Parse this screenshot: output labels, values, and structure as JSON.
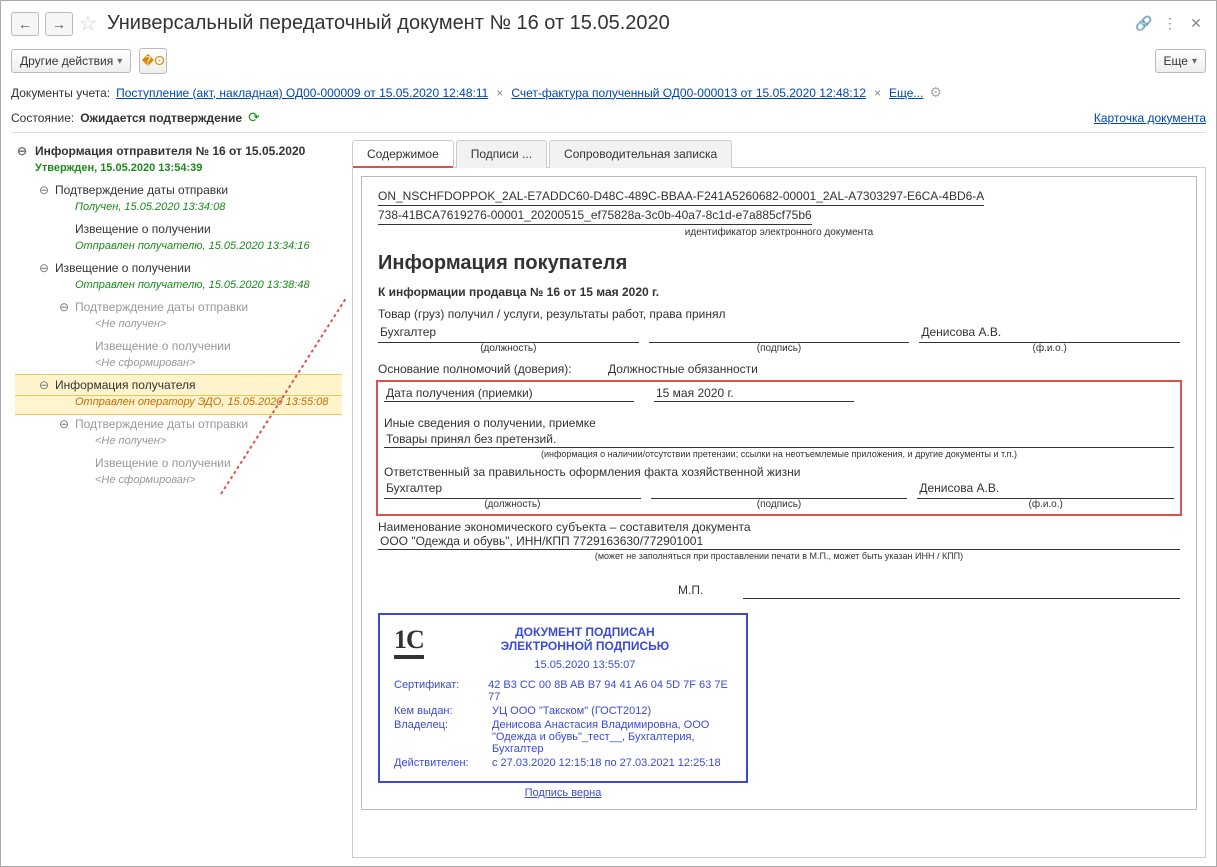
{
  "title": "Универсальный передаточный документ № 16 от 15.05.2020",
  "toolbar": {
    "other_actions": "Другие действия",
    "more": "Еще"
  },
  "docs": {
    "label": "Документы учета:",
    "link1": "Поступление (акт, накладная) ОД00-000009 от 15.05.2020 12:48:11",
    "link2": "Счет-фактура полученный ОД00-000013 от 15.05.2020 12:48:12",
    "more": "Еще..."
  },
  "state": {
    "label": "Состояние:",
    "value": "Ожидается подтверждение"
  },
  "card_link": "Карточка документа",
  "tree": {
    "root": "Информация отправителя № 16 от 15.05.2020",
    "root_status": "Утвержден, 15.05.2020 13:54:39",
    "n1": "Подтверждение даты отправки",
    "n1_status": "Получен, 15.05.2020 13:34:08",
    "n1a": "Извещение о получении",
    "n1a_status": "Отправлен получателю, 15.05.2020 13:34:16",
    "n2": "Извещение о получении",
    "n2_status": "Отправлен получателю, 15.05.2020 13:38:48",
    "n2a": "Подтверждение даты отправки",
    "n2a_status": "<Не получен>",
    "n2a1": "Извещение о получении",
    "n2a1_status": "<Не сформирован>",
    "n3": "Информация получателя",
    "n3_status": "Отправлен оператору ЭДО, 15.05.2020 13:55:08",
    "n3a": "Подтверждение даты отправки",
    "n3a_status": "<Не получен>",
    "n3a1": "Извещение о получении",
    "n3a1_status": "<Не сформирован>"
  },
  "tabs": {
    "t1": "Содержимое",
    "t2": "Подписи ...",
    "t3": "Сопроводительная записка"
  },
  "doc": {
    "file_id1": "ON_NSCHFDOPPOK_2AL-E7ADDC60-D48C-489C-BBAA-F241A5260682-00001_2AL-A7303297-E6CA-4BD6-A",
    "file_id2": "738-41BCA7619276-00001_20200515_ef75828a-3c0b-40a7-8c1d-e7a885cf75b6",
    "file_id_cap": "идентификатор электронного документа",
    "h1": "Информация покупателя",
    "sub": "К информации продавца № 16 от 15 мая 2020 г.",
    "received_label": "Товар (груз) получил / услуги, результаты работ, права принял",
    "position_cap": "(должность)",
    "signature_cap": "(подпись)",
    "fio_cap": "(ф.и.о.)",
    "position_value": "Бухгалтер",
    "fio_value": "Денисова А.В.",
    "auth_label": "Основание полномочий (доверия):",
    "auth_value": "Должностные обязанности",
    "date_label": "Дата получения (приемки)",
    "date_value": "15 мая 2020 г.",
    "other_label": "Иные сведения о получении, приемке",
    "other_value": "Товары принял без претензий.",
    "other_cap": "(информация о наличии/отсутствии претензии; ссылки на неотъемлемые приложения, и другие  документы и т.п.)",
    "resp_label": "Ответственный за правильность оформления факта хозяйственной жизни",
    "resp_position": "Бухгалтер",
    "resp_fio": "Денисова А.В.",
    "subj_label": "Наименование экономического субъекта – составителя документа",
    "subj_value": "ООО \"Одежда и обувь\", ИНН/КПП 7729163630/772901001",
    "subj_cap": "(может не заполняться при проставлении печати в М.П., может быть указан ИНН / КПП)",
    "mp": "М.П.",
    "stamp": {
      "title1": "ДОКУМЕНТ ПОДПИСАН",
      "title2": "ЭЛЕКТРОННОЙ ПОДПИСЬЮ",
      "date": "15.05.2020 13:55:07",
      "cert_k": "Сертификат:",
      "cert_v": "42 B3 CC 00 8B AB B7 94 41 A6 04 5D 7F 63 7E 77",
      "issuer_k": "Кем выдан:",
      "issuer_v": "УЦ ООО \"Такском\" (ГОСТ2012)",
      "owner_k": "Владелец:",
      "owner_v": "Денисова Анастасия Владимировна, ООО \"Одежда и обувь\"_тест__, Бухгалтерия, Бухгалтер",
      "valid_k": "Действителен:",
      "valid_v": "с 27.03.2020 12:15:18 по 27.03.2021 12:25:18",
      "verified": "Подпись верна"
    }
  }
}
